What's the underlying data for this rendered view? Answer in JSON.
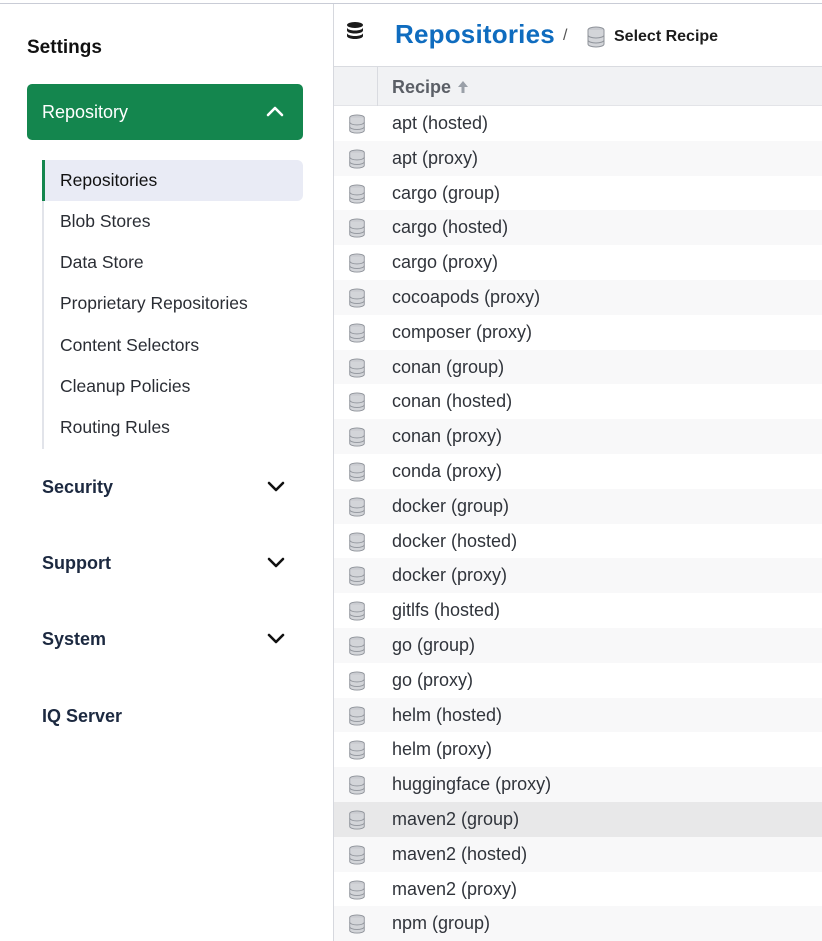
{
  "sidebar": {
    "title": "Settings",
    "repository": {
      "label": "Repository"
    },
    "subnav": [
      {
        "label": "Repositories",
        "active": true
      },
      {
        "label": "Blob Stores"
      },
      {
        "label": "Data Store"
      },
      {
        "label": "Proprietary Repositories"
      },
      {
        "label": "Content Selectors"
      },
      {
        "label": "Cleanup Policies"
      },
      {
        "label": "Routing Rules"
      }
    ],
    "sections": [
      {
        "label": "Security"
      },
      {
        "label": "Support"
      },
      {
        "label": "System"
      },
      {
        "label": "IQ Server"
      }
    ],
    "accent_color": "#14864e"
  },
  "header": {
    "icon": "database-icon",
    "title": "Repositories",
    "separator": "/",
    "current": "Select Recipe",
    "title_color": "#0f6cbf"
  },
  "table": {
    "column": "Recipe",
    "sort_icon": "arrow-up-icon",
    "rows": [
      "apt (hosted)",
      "apt (proxy)",
      "cargo (group)",
      "cargo (hosted)",
      "cargo (proxy)",
      "cocoapods (proxy)",
      "composer (proxy)",
      "conan (group)",
      "conan (hosted)",
      "conan (proxy)",
      "conda (proxy)",
      "docker (group)",
      "docker (hosted)",
      "docker (proxy)",
      "gitlfs (hosted)",
      "go (group)",
      "go (proxy)",
      "helm (hosted)",
      "helm (proxy)",
      "huggingface (proxy)",
      "maven2 (group)",
      "maven2 (hosted)",
      "maven2 (proxy)",
      "npm (group)"
    ],
    "selected": "maven2 (group)"
  }
}
